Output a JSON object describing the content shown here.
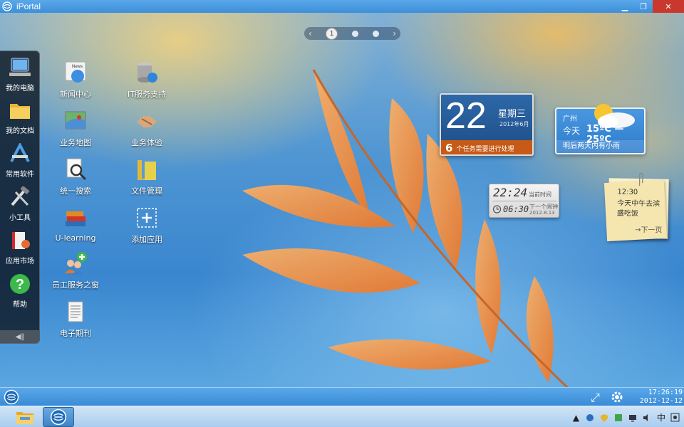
{
  "window": {
    "title": "iPortal"
  },
  "pager": {
    "current": "1"
  },
  "dock": {
    "items": [
      {
        "label": "我的电脑"
      },
      {
        "label": "我的文档"
      },
      {
        "label": "常用软件"
      },
      {
        "label": "小工具"
      },
      {
        "label": "应用市场"
      },
      {
        "label": "帮助"
      }
    ]
  },
  "apps": [
    {
      "label": "新闻中心",
      "badge": "News"
    },
    {
      "label": "IT服务支持"
    },
    {
      "label": "业务地图"
    },
    {
      "label": "业务体验"
    },
    {
      "label": "统一搜索"
    },
    {
      "label": "文件管理"
    },
    {
      "label": "U-learning"
    },
    {
      "label": "添加应用"
    },
    {
      "label": "员工服务之窗"
    },
    {
      "label": "电子期刊"
    }
  ],
  "calendar": {
    "day": "22",
    "weekday": "星期三",
    "year_month": "2012年6月",
    "task_count": "6",
    "task_text": "个任务需要进行处理"
  },
  "clock": {
    "current_time": "22:24",
    "current_label": "当前时间",
    "alarm_time": "06:30",
    "alarm_label": "下一个闹钟",
    "alarm_date": "2012.8.13"
  },
  "weather": {
    "city": "广州",
    "day_label": "今天",
    "temperature": "15ºC — 25ºC",
    "forecast": "明后两天内有小雨"
  },
  "note": {
    "time": "12:30",
    "text": "今天中午去滨盛吃饭",
    "next_label": "下一页"
  },
  "statusbar": {
    "time": "17:26:19",
    "date": "2012-12-12"
  },
  "tray": {
    "ime": "中"
  },
  "colors": {
    "accent": "#3d8fd9",
    "task_orange": "#c65a16",
    "close_red": "#c9382d"
  }
}
